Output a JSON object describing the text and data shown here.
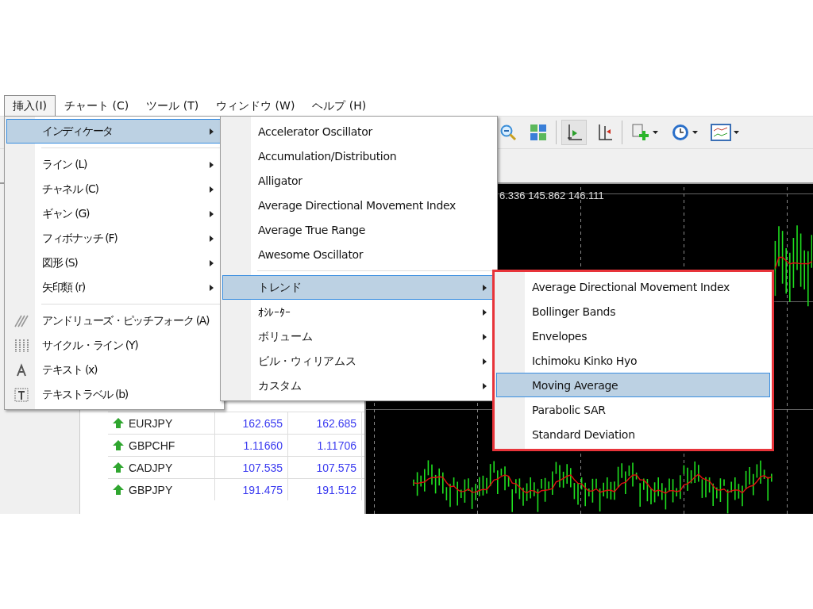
{
  "menubar": [
    {
      "label": "挿入(I)",
      "selected": true
    },
    {
      "label": "チャート (C)",
      "selected": false
    },
    {
      "label": "ツール (T)",
      "selected": false
    },
    {
      "label": "ウィンドウ (W)",
      "selected": false
    },
    {
      "label": "ヘルプ (H)",
      "selected": false
    }
  ],
  "chart_header": "6.336 145.862 146.111",
  "market_watch": {
    "rows": [
      {
        "symbol": "EURJPY",
        "bid": "162.655",
        "ask": "162.685"
      },
      {
        "symbol": "GBPCHF",
        "bid": "1.11660",
        "ask": "1.11706"
      },
      {
        "symbol": "CADJPY",
        "bid": "107.535",
        "ask": "107.575"
      },
      {
        "symbol": "GBPJPY",
        "bid": "191.475",
        "ask": "191.512"
      }
    ]
  },
  "insert_menu": {
    "sections": [
      [
        {
          "label": "インディケータ",
          "selected": true,
          "submenu": true
        }
      ],
      [
        {
          "label": "ライン (L)",
          "selected": false,
          "submenu": true
        },
        {
          "label": "チャネル (C)",
          "selected": false,
          "submenu": true
        },
        {
          "label": "ギャン (G)",
          "selected": false,
          "submenu": true
        },
        {
          "label": "フィボナッチ (F)",
          "selected": false,
          "submenu": true
        },
        {
          "label": "図形 (S)",
          "selected": false,
          "submenu": true
        },
        {
          "label": "矢印類 (r)",
          "selected": false,
          "submenu": true
        }
      ],
      [
        {
          "label": "アンドリューズ・ピッチフォーク (A)",
          "selected": false,
          "submenu": false
        },
        {
          "label": "サイクル・ライン (Y)",
          "selected": false,
          "submenu": false
        },
        {
          "label": "テキスト (x)",
          "selected": false,
          "submenu": false
        },
        {
          "label": "テキストラベル (b)",
          "selected": false,
          "submenu": false
        }
      ]
    ]
  },
  "indicator_menu": {
    "sections": [
      [
        {
          "label": "Accelerator Oscillator",
          "selected": false,
          "submenu": false
        },
        {
          "label": "Accumulation/Distribution",
          "selected": false,
          "submenu": false
        },
        {
          "label": "Alligator",
          "selected": false,
          "submenu": false
        },
        {
          "label": "Average Directional Movement Index",
          "selected": false,
          "submenu": false
        },
        {
          "label": "Average True Range",
          "selected": false,
          "submenu": false
        },
        {
          "label": "Awesome Oscillator",
          "selected": false,
          "submenu": false
        }
      ],
      [
        {
          "label": "トレンド",
          "selected": true,
          "submenu": true
        },
        {
          "label": "ｵｼﾚｰﾀｰ",
          "selected": false,
          "submenu": true
        },
        {
          "label": "ボリューム",
          "selected": false,
          "submenu": true
        },
        {
          "label": "ビル・ウィリアムス",
          "selected": false,
          "submenu": true
        },
        {
          "label": "カスタム",
          "selected": false,
          "submenu": true
        }
      ]
    ]
  },
  "trend_menu": {
    "outlined": true,
    "sections": [
      [
        {
          "label": "Average Directional Movement Index",
          "selected": false,
          "submenu": false
        },
        {
          "label": "Bollinger Bands",
          "selected": false,
          "submenu": false
        },
        {
          "label": "Envelopes",
          "selected": false,
          "submenu": false
        },
        {
          "label": "Ichimoku Kinko Hyo",
          "selected": false,
          "submenu": false
        },
        {
          "label": "Moving Average",
          "selected": true,
          "submenu": false
        },
        {
          "label": "Parabolic SAR",
          "selected": false,
          "submenu": false
        },
        {
          "label": "Standard Deviation",
          "selected": false,
          "submenu": false
        }
      ]
    ]
  }
}
